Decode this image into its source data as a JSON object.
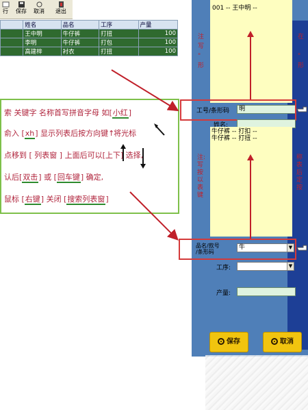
{
  "toolbar": {
    "items": [
      {
        "label": "行"
      },
      {
        "label": "保存"
      },
      {
        "label": "取消"
      },
      {
        "label": "退出"
      }
    ]
  },
  "grid": {
    "headers": [
      "姓名",
      "品名",
      "工序",
      "产量"
    ],
    "rows": [
      {
        "name": "王中明",
        "product": "牛仔裤",
        "process": "打扭",
        "qty": "100"
      },
      {
        "name": "李明",
        "product": "牛仔裤",
        "process": "打包",
        "qty": "100"
      },
      {
        "name": "高建梓",
        "product": "衬衣",
        "process": "打扭",
        "qty": "100"
      }
    ]
  },
  "instructions": {
    "l1a": "索 关键字 名称首写拼音字母 如[",
    "l1b": "小红",
    "l1c": "]",
    "l2a": "俞入 [",
    "l2b": "xh",
    "l2c": "] 显示列表后按方向键",
    "l2d": "将光标",
    "l3a": "点移到 [ 列表窗 ] 上面后可以[",
    "l3b": "上下",
    "l3c": "] 选择,",
    "l4a": "认后[",
    "l4b": "双击",
    "l4c": "] 或 [",
    "l4d": "回车键",
    "l4e": "] 确定,",
    "l5a": "鼠标 [",
    "l5b": "右键",
    "l5c": "] 关闭 [",
    "l5d": "搜索列表窗",
    "l5e": "]"
  },
  "right": {
    "list1": "001 -- 王中明 --",
    "note_left_1": "注",
    "note_left_2": "写",
    "note_left_3": "\"",
    "note_left_4": "形",
    "note_right_1": "在",
    "note_right_2": "\"",
    "note_right_3": "形",
    "worker_label": "工号/条形码",
    "worker_value": "明",
    "name_label": "姓名:",
    "list2_line1": "牛仔裤 -- 打扣 --",
    "list2_line2": "牛仔裤 -- 打扭 --",
    "note2_left": [
      "注:",
      "写",
      "按",
      "以",
      "表",
      "键"
    ],
    "note2_right": [
      "称",
      "表",
      "后",
      "定",
      "按"
    ],
    "product_label_1": "品名/款号",
    "product_label_2": "/条形码",
    "product_value": "牛",
    "process_label": "工序:",
    "qty_label": "产量:",
    "save_label": "保存",
    "cancel_label": "取消"
  },
  "colors": {
    "row_green": "#2f6a2f",
    "panel_blue": "#4f7fb8",
    "annotation_red": "#d43a3a",
    "box_green": "#7ec04a",
    "text_red": "#b0243c",
    "button_yellow": "#f1c40f"
  }
}
